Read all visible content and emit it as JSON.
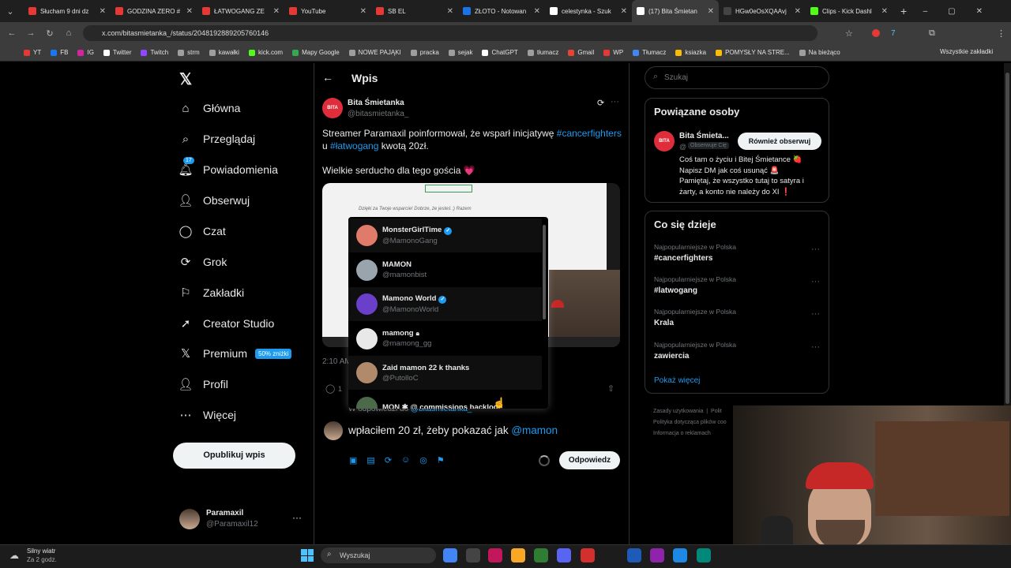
{
  "browser": {
    "tabs": [
      {
        "title": "Słucham 9 dni dz",
        "color": "#e53935"
      },
      {
        "title": "GODZINA ZERO #",
        "color": "#e53935"
      },
      {
        "title": "ŁATWOGANG ZE",
        "color": "#e53935"
      },
      {
        "title": "YouTube",
        "color": "#e53935"
      },
      {
        "title": "SB EL",
        "color": "#e53935"
      },
      {
        "title": "ZŁOTO - Notowan",
        "color": "#1a73e8"
      },
      {
        "title": "celestynka - Szuk",
        "color": "#ffffff"
      },
      {
        "title": "(17) Bita Śmietan",
        "color": "#ffffff"
      },
      {
        "title": "HGw0eOsXQAAvj",
        "color": "#444"
      },
      {
        "title": "Clips - Kick Dashl",
        "color": "#53fc18"
      }
    ],
    "new_tab": "+",
    "url": "x.com/bitasmietanka_/status/2048192889205760146",
    "bookmarks": [
      {
        "label": "YT",
        "color": "#e53935"
      },
      {
        "label": "FB",
        "color": "#1877f2"
      },
      {
        "label": "IG",
        "color": "#d6249f"
      },
      {
        "label": "Twitter",
        "color": "#ffffff"
      },
      {
        "label": "Twitch",
        "color": "#9146ff"
      },
      {
        "label": "strm",
        "color": "#9e9e9e"
      },
      {
        "label": "kawałki",
        "color": "#9e9e9e"
      },
      {
        "label": "kick.com",
        "color": "#53fc18"
      },
      {
        "label": "Mapy Google",
        "color": "#34a853"
      },
      {
        "label": "NOWE PAJĄKI",
        "color": "#9e9e9e"
      },
      {
        "label": "pracka",
        "color": "#9e9e9e"
      },
      {
        "label": "sejak",
        "color": "#9e9e9e"
      },
      {
        "label": "ChatGPT",
        "color": "#ffffff"
      },
      {
        "label": "tłumacz",
        "color": "#9e9e9e"
      },
      {
        "label": "Gmail",
        "color": "#ea4335"
      },
      {
        "label": "WP",
        "color": "#e53935"
      },
      {
        "label": "Tłumacz",
        "color": "#4285f4"
      },
      {
        "label": "ksiazka",
        "color": "#fbbc04"
      },
      {
        "label": "POMYSŁY NA STRE...",
        "color": "#fbbc04"
      },
      {
        "label": "Na bieżąco",
        "color": "#9e9e9e"
      }
    ],
    "all_bookmarks": "Wszystkie zakładki"
  },
  "sidebar": {
    "items": [
      {
        "label": "Główna",
        "icon": "home-icon"
      },
      {
        "label": "Przeglądaj",
        "icon": "search-icon"
      },
      {
        "label": "Powiadomienia",
        "icon": "bell-icon",
        "badge": "17"
      },
      {
        "label": "Obserwuj",
        "icon": "follow-icon"
      },
      {
        "label": "Czat",
        "icon": "chat-icon"
      },
      {
        "label": "Grok",
        "icon": "grok-icon"
      },
      {
        "label": "Zakładki",
        "icon": "bookmark-icon"
      },
      {
        "label": "Creator Studio",
        "icon": "rocket-icon"
      },
      {
        "label": "Premium",
        "icon": "x-icon",
        "badge": "50% zniżki"
      },
      {
        "label": "Profil",
        "icon": "profile-icon"
      },
      {
        "label": "Więcej",
        "icon": "more-icon"
      }
    ],
    "post_button": "Opublikuj wpis",
    "account": {
      "name": "Paramaxil",
      "handle": "@Paramaxil12"
    }
  },
  "main": {
    "header_title": "Wpis",
    "author": {
      "name": "Bita Śmietanka",
      "handle": "@bitasmietanka_"
    },
    "text_1a": "Streamer Paramaxil poinformował, że wsparł inicjatywę ",
    "hashtag_1": "#cancerfighters",
    "text_1b": "u ",
    "hashtag_2": "#łatwogang",
    "text_1c": " kwotą 20zł.",
    "text_2": "Wielkie serducho dla tego gościa 💗",
    "media_quote": "Dzięki za Twoje wsparcie! Dobrze, że jesteś :) Razem",
    "timestamp": "2:10 AM",
    "reply_count": "1",
    "reply_to_prefix": "W odpowiedzi do ",
    "reply_to_handle": "@bitasmietanka_",
    "reply_text": "wpłaciłem 20 zł, żeby pokazać jak ",
    "reply_mention": "@mamon",
    "reply_button": "Odpowiedz"
  },
  "dropdown": [
    {
      "name": "MonsterGirlTime",
      "handle": "@MamonoGang",
      "verified": true,
      "lock": false,
      "color": "#e07a6a"
    },
    {
      "name": "MAMON",
      "handle": "@mamonbist",
      "verified": false,
      "lock": false,
      "color": "#9aa4ad"
    },
    {
      "name": "Mamono World",
      "handle": "@MamonoWorld",
      "verified": true,
      "lock": false,
      "color": "#6a3fc9"
    },
    {
      "name": "mamong",
      "handle": "@mamong_gg",
      "verified": false,
      "lock": true,
      "color": "#e8e8e8"
    },
    {
      "name": "Zaid mamon 22 k thanks",
      "handle": "@PutolloC",
      "verified": false,
      "lock": false,
      "color": "#b08a6a"
    },
    {
      "name": "MON ✱ @ commissions backlog!!",
      "handle": "",
      "verified": false,
      "lock": false,
      "color": "#4a6a4a"
    }
  ],
  "right": {
    "search_placeholder": "Szukaj",
    "related_title": "Powiązane osoby",
    "related": {
      "name": "Bita Śmieta...",
      "handle": "@",
      "follows_you": "Obserwuje Cię",
      "button": "Również obserwuj",
      "bio_1": "Coś tam o życiu i Bitej Śmietance 🍓",
      "bio_2": "Napisz DM jak coś usunąć 🚨",
      "bio_3": "Pamiętaj, że wszystko tutaj to satyra i",
      "bio_4": "żarty, a konto nie należy do XI ❗"
    },
    "trends_title": "Co się dzieje",
    "trends": [
      {
        "label": "Najpopularniejsze w Polska",
        "name": "#cancerfighters"
      },
      {
        "label": "Najpopularniejsze w Polska",
        "name": "#latwogang"
      },
      {
        "label": "Najpopularniejsze w Polska",
        "name": "Krala"
      },
      {
        "label": "Najpopularniejsze w Polska",
        "name": "zawiercia"
      }
    ],
    "show_more": "Pokaż więcej",
    "footer_1": "Zasady użytkowania",
    "footer_1b": "Polit",
    "footer_2": "Polityka dotycząca plików coo",
    "footer_3": "Informacja o reklamach"
  },
  "taskbar": {
    "weather_title": "Silny wiatr",
    "weather_sub": "Za 2 godz.",
    "search": "Wyszukaj"
  }
}
